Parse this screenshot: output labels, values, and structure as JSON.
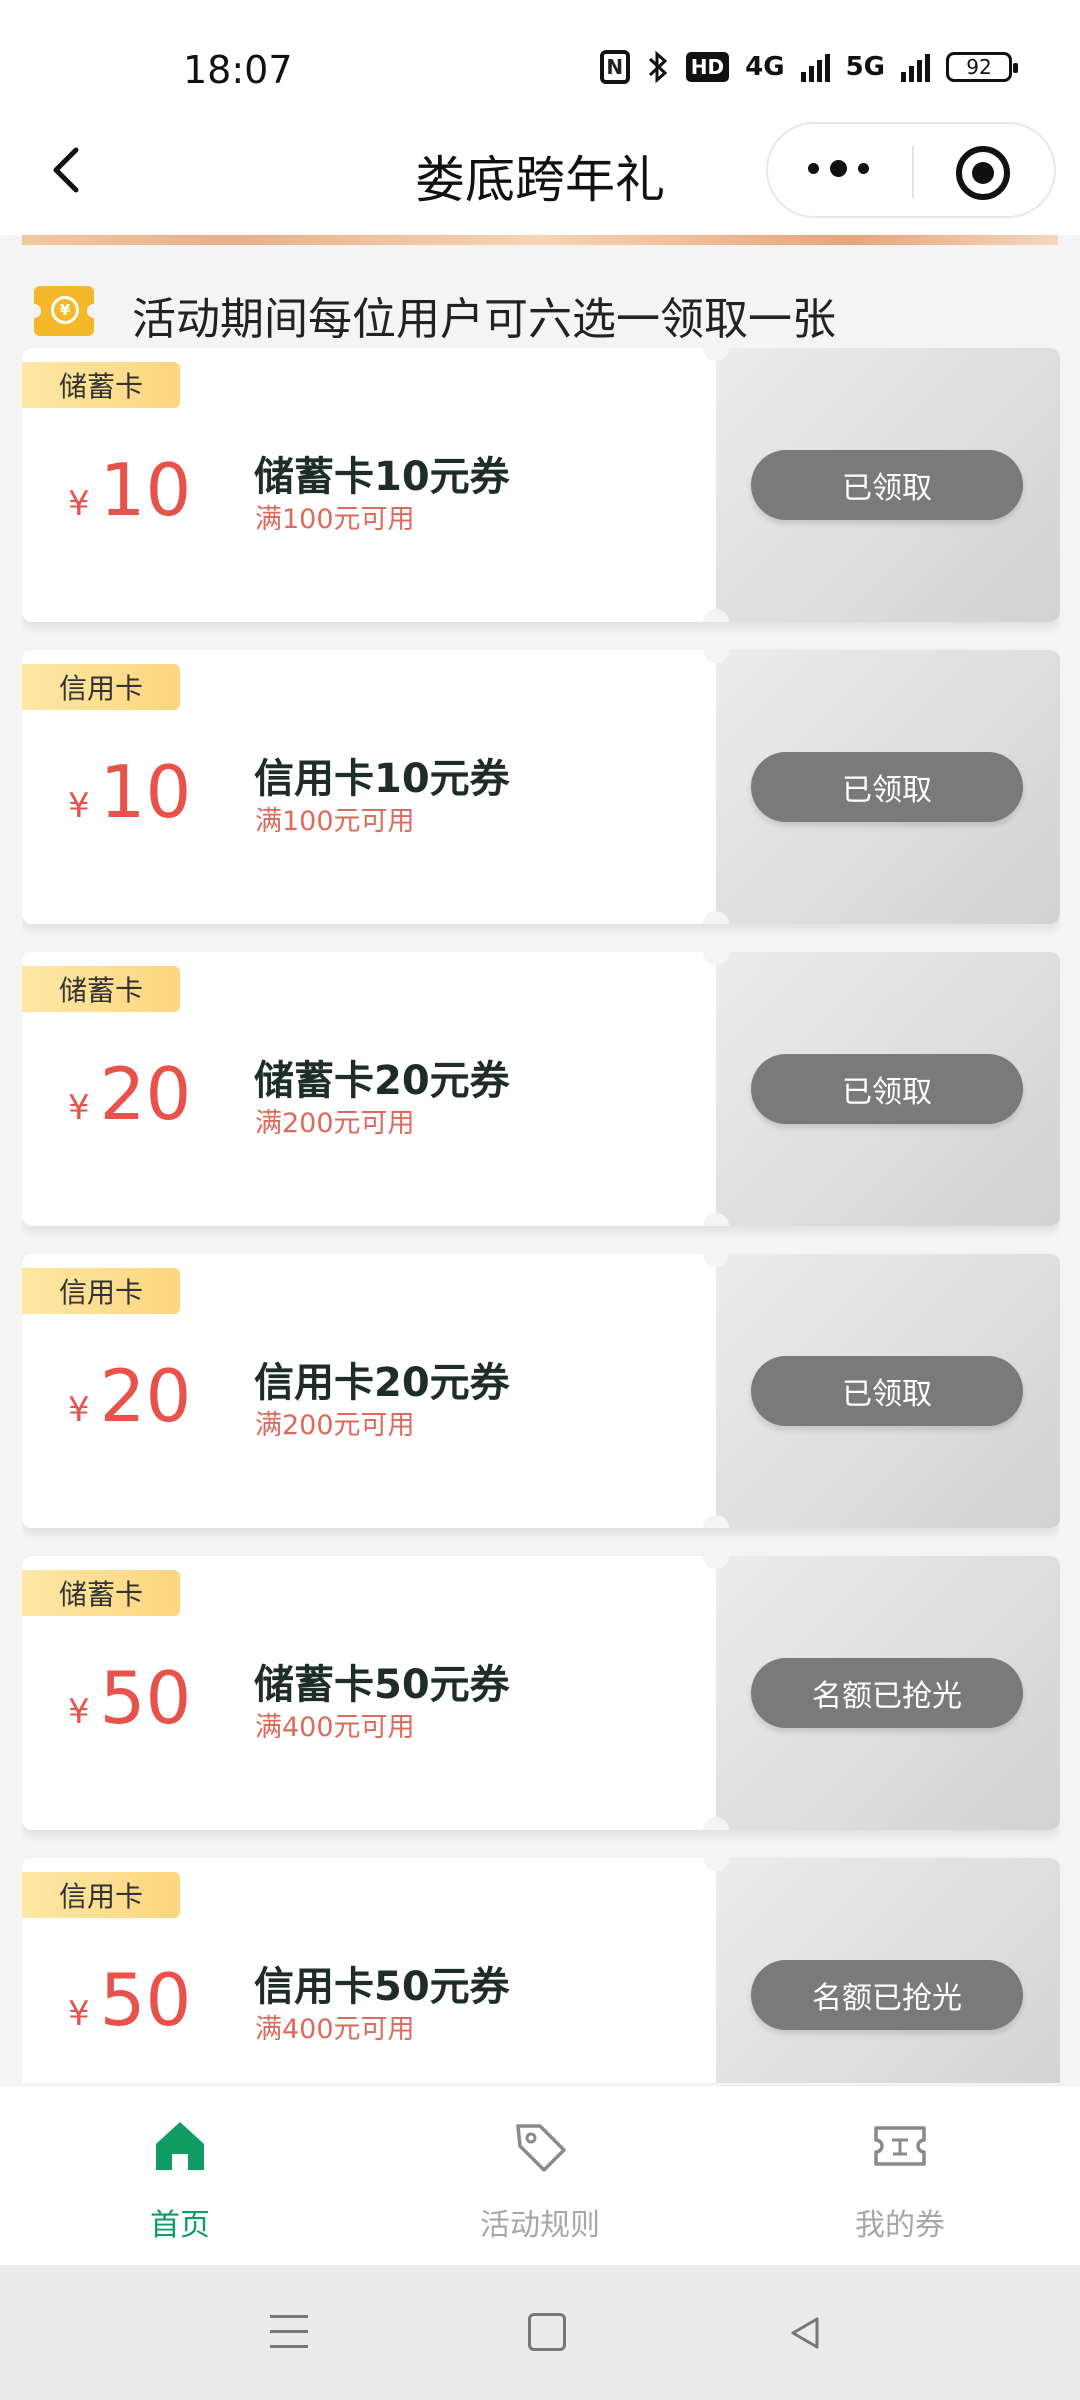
{
  "status_bar": {
    "time": "18:07",
    "icons": [
      "nfc-icon",
      "bluetooth-icon",
      "hd-icon",
      "4g-signal-icon",
      "5g-signal-icon",
      "battery-icon"
    ],
    "hd_label": "HD",
    "net1_label": "4G",
    "net2_label": "5G",
    "battery": "92"
  },
  "nav": {
    "title": "娄底跨年礼"
  },
  "notice": {
    "text": "活动期间每位用户可六选一领取一张"
  },
  "coupons": [
    {
      "tag": "储蓄卡",
      "yen": "¥",
      "amount": "10",
      "name": "储蓄卡10元券",
      "condition": "满100元可用",
      "button": "已领取"
    },
    {
      "tag": "信用卡",
      "yen": "¥",
      "amount": "10",
      "name": "信用卡10元券",
      "condition": "满100元可用",
      "button": "已领取"
    },
    {
      "tag": "储蓄卡",
      "yen": "¥",
      "amount": "20",
      "name": "储蓄卡20元券",
      "condition": "满200元可用",
      "button": "已领取"
    },
    {
      "tag": "信用卡",
      "yen": "¥",
      "amount": "20",
      "name": "信用卡20元券",
      "condition": "满200元可用",
      "button": "已领取"
    },
    {
      "tag": "储蓄卡",
      "yen": "¥",
      "amount": "50",
      "name": "储蓄卡50元券",
      "condition": "满400元可用",
      "button": "名额已抢光"
    },
    {
      "tag": "信用卡",
      "yen": "¥",
      "amount": "50",
      "name": "信用卡50元券",
      "condition": "满400元可用",
      "button": "名额已抢光"
    }
  ],
  "tabs": [
    {
      "label": "首页",
      "icon": "home-icon",
      "active": true
    },
    {
      "label": "活动规则",
      "icon": "tag-icon",
      "active": false
    },
    {
      "label": "我的券",
      "icon": "ticket-icon",
      "active": false
    }
  ],
  "colors": {
    "accent_green": "#0e9c62",
    "coupon_red": "#e8524a",
    "tag_yellow": "#fdd67e",
    "button_gray": "#7a7a7a"
  }
}
